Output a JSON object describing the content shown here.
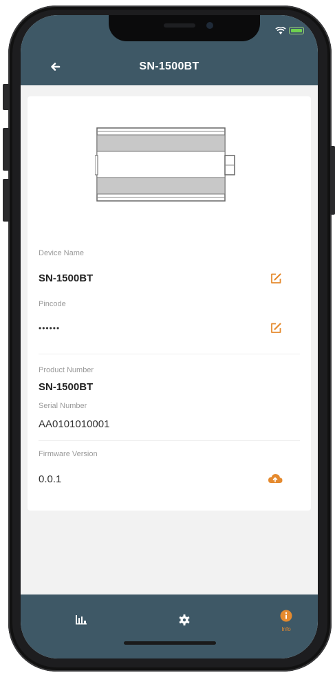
{
  "app_bar": {
    "title": "SN-1500BT"
  },
  "device": {
    "device_name_label": "Device Name",
    "device_name": "SN-1500BT",
    "pincode_label": "Pincode",
    "pincode": "••••••",
    "product_number_label": "Product Number",
    "product_number": "SN-1500BT",
    "serial_number_label": "Serial Number",
    "serial_number": "AA0101010001",
    "firmware_label": "Firmware Version",
    "firmware_version": "0.0.1"
  },
  "tabs": [
    {
      "name": "stats",
      "icon": "bar-chart-icon"
    },
    {
      "name": "settings",
      "icon": "gear-icon"
    },
    {
      "name": "info",
      "icon": "info-icon",
      "label": "Info",
      "active": true
    }
  ],
  "colors": {
    "header": "#3e5866",
    "accent": "#e58a2e",
    "background": "#f2f2f2",
    "card": "#ffffff"
  }
}
